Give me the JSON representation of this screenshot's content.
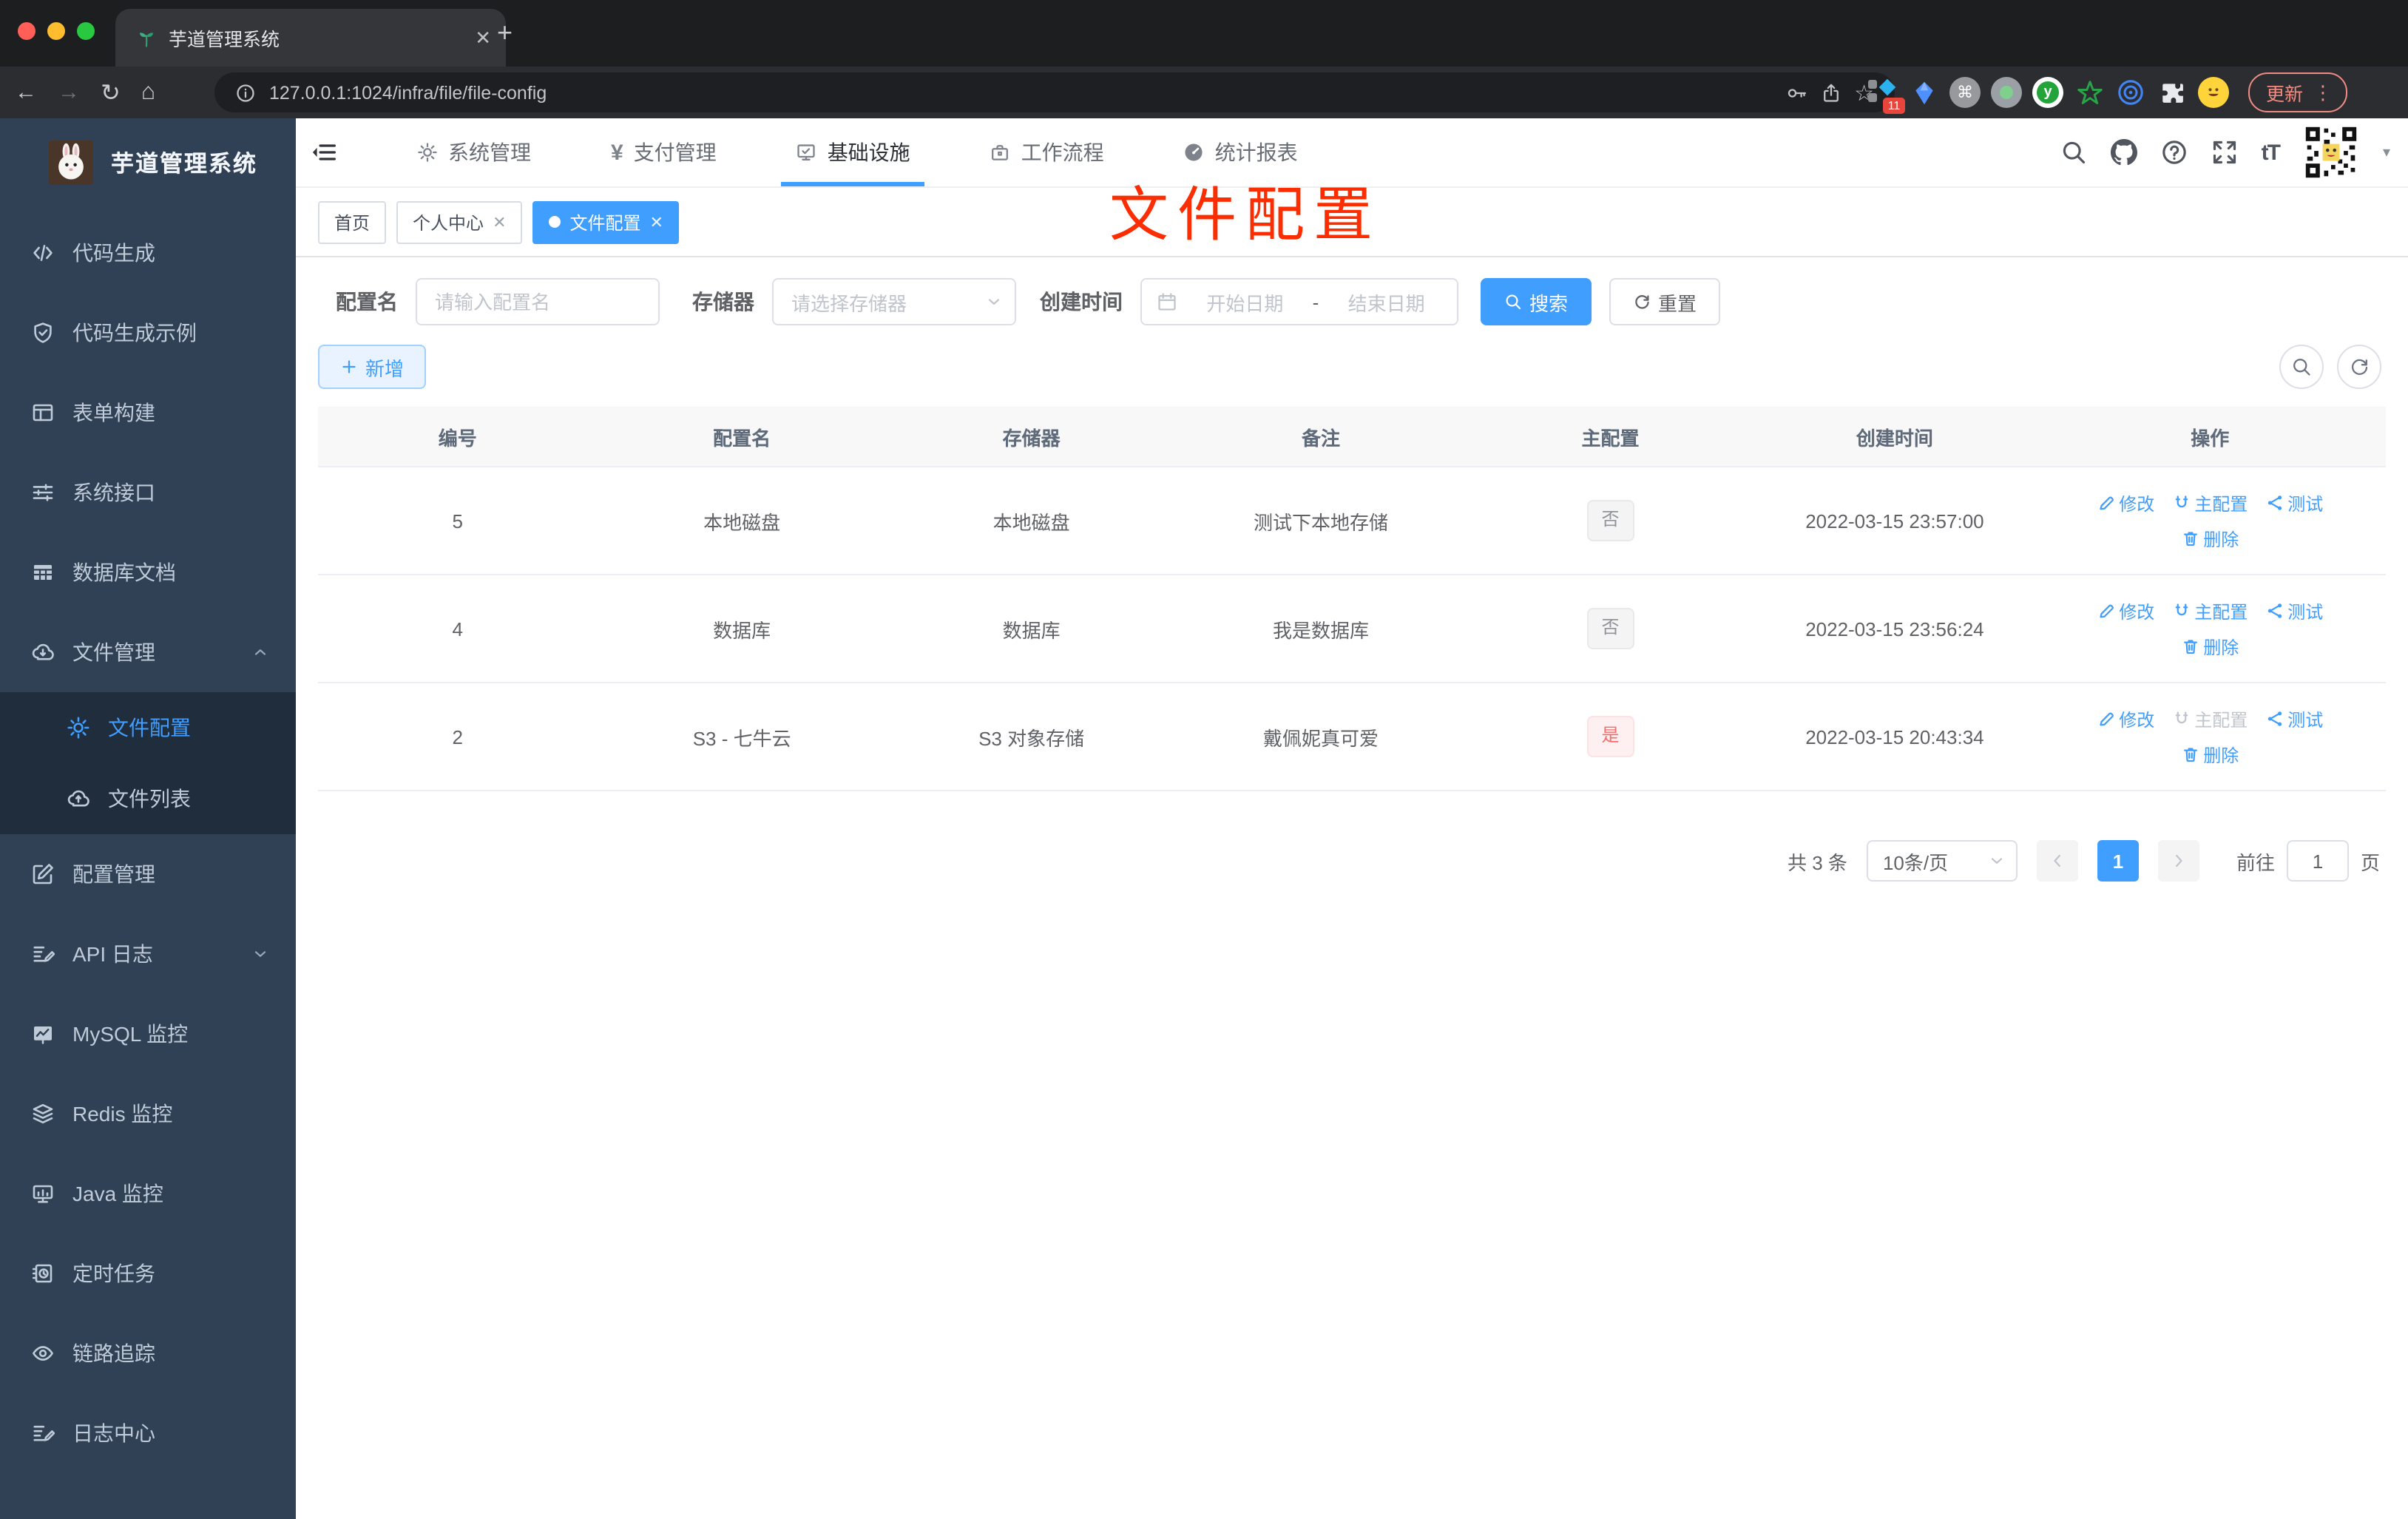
{
  "browser": {
    "tab_title": "芋道管理系统",
    "url": "127.0.0.1:1024/infra/file/file-config",
    "update_label": "更新",
    "extension_badge": "11"
  },
  "sidebar": {
    "title": "芋道管理系统",
    "items": [
      {
        "label": "代码生成",
        "icon": "code-icon"
      },
      {
        "label": "代码生成示例",
        "icon": "shield-check-icon"
      },
      {
        "label": "表单构建",
        "icon": "form-grid-icon"
      },
      {
        "label": "系统接口",
        "icon": "sliders-icon"
      },
      {
        "label": "数据库文档",
        "icon": "table-solid-icon"
      },
      {
        "label": "文件管理",
        "icon": "cloud-download-icon",
        "expanded": true
      },
      {
        "label": "文件配置",
        "icon": "gear-icon",
        "active": true
      },
      {
        "label": "文件列表",
        "icon": "cloud-upload-icon"
      },
      {
        "label": "配置管理",
        "icon": "edit-square-icon"
      },
      {
        "label": "API 日志",
        "icon": "doc-edit-icon",
        "collapsed": true
      },
      {
        "label": "MySQL 监控",
        "icon": "chart-monitor-icon"
      },
      {
        "label": "Redis 监控",
        "icon": "layers-icon"
      },
      {
        "label": "Java 监控",
        "icon": "display-icon"
      },
      {
        "label": "定时任务",
        "icon": "schedule-icon"
      },
      {
        "label": "链路追踪",
        "icon": "eye-icon"
      },
      {
        "label": "日志中心",
        "icon": "doc-edit-icon"
      }
    ]
  },
  "topnav": {
    "items": [
      {
        "label": "系统管理",
        "icon": "gear-icon"
      },
      {
        "label": "支付管理",
        "icon": "yen-icon"
      },
      {
        "label": "基础设施",
        "icon": "monitor-check-icon",
        "active": true
      },
      {
        "label": "工作流程",
        "icon": "briefcase-icon"
      },
      {
        "label": "统计报表",
        "icon": "gauge-icon"
      }
    ]
  },
  "tabs": {
    "items": [
      {
        "label": "首页"
      },
      {
        "label": "个人中心",
        "closable": true
      },
      {
        "label": "文件配置",
        "closable": true,
        "active": true
      }
    ]
  },
  "annotation": {
    "text": "文件配置"
  },
  "filters": {
    "name_label": "配置名",
    "name_placeholder": "请输入配置名",
    "storage_label": "存储器",
    "storage_placeholder": "请选择存储器",
    "time_label": "创建时间",
    "start_placeholder": "开始日期",
    "range_separator": "-",
    "end_placeholder": "结束日期",
    "search_label": "搜索",
    "reset_label": "重置"
  },
  "toolbar": {
    "add_label": "新增"
  },
  "table": {
    "columns": [
      "编号",
      "配置名",
      "存储器",
      "备注",
      "主配置",
      "创建时间",
      "操作"
    ],
    "action_labels": {
      "edit": "修改",
      "master": "主配置",
      "test": "测试",
      "remove": "删除"
    },
    "rows": [
      {
        "id": "5",
        "name": "本地磁盘",
        "storage": "本地磁盘",
        "remark": "测试下本地存储",
        "primary": "否",
        "created": "2022-03-15 23:57:00"
      },
      {
        "id": "4",
        "name": "数据库",
        "storage": "数据库",
        "remark": "我是数据库",
        "primary": "否",
        "created": "2022-03-15 23:56:24"
      },
      {
        "id": "2",
        "name": "S3 - 七牛云",
        "storage": "S3 对象存储",
        "remark": "戴佩妮真可爱",
        "primary": "是",
        "created": "2022-03-15 20:43:34"
      }
    ]
  },
  "pagination": {
    "total": "共 3 条",
    "page_size": "10条/页",
    "current_page": "1",
    "goto_label": "前往",
    "goto_value": "1",
    "page_suffix": "页"
  },
  "icons": {
    "search": "magnifier shape",
    "refresh": "circular arrow",
    "gear": "settings cog",
    "github": "github mark",
    "help": "question circle",
    "fullscreen": "expand arrows",
    "font-size": "tT glyph",
    "edit": "pencil",
    "master": "magnet U",
    "test": "share nodes",
    "delete": "trash can",
    "calendar": "date picker",
    "plus": "add",
    "favicon": "green sprout"
  },
  "colors": {
    "accent": "#409eff",
    "danger": "#f56c6c",
    "sidebar": "#304156",
    "submenu": "#1f2d3d",
    "annotation": "#fc2e01"
  }
}
